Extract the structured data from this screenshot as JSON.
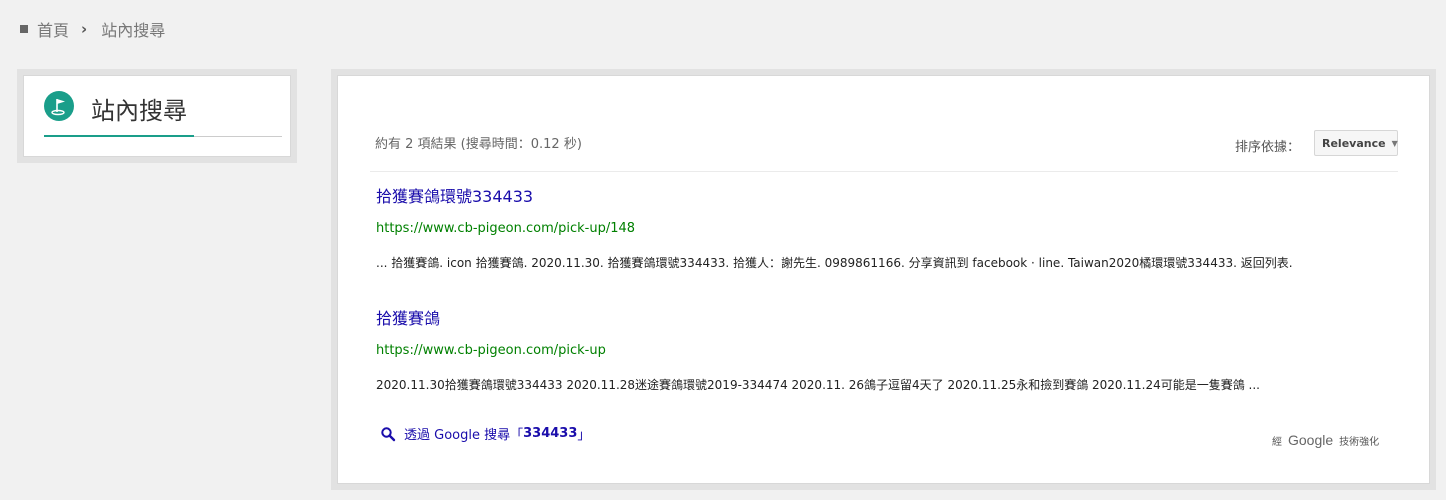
{
  "breadcrumb": {
    "home": "首頁",
    "current": "站內搜尋"
  },
  "sidebar": {
    "title": "站內搜尋",
    "accent_color": "#1a9e8a",
    "icon": "golf-flag-icon"
  },
  "results_header": {
    "summary": "約有 2 項結果 (搜尋時間：0.12 秒)",
    "sort_label": "排序依據：",
    "sort_value": "Relevance"
  },
  "results": [
    {
      "title": "拾獲賽鴿環號334433",
      "url": "https://www.cb-pigeon.com/pick-up/148",
      "snippet": "... 拾獲賽鴿. icon 拾獲賽鴿. 2020.11.30. 拾獲賽鴿環號334433. 拾獲人：謝先生. 0989861166. 分享資訊到 facebook · line. Taiwan2020橘環環號334433. 返回列表."
    },
    {
      "title": "拾獲賽鴿",
      "url": "https://www.cb-pigeon.com/pick-up",
      "snippet": "2020.11.30拾獲賽鴿環號334433 2020.11.28迷途賽鴿環號2019-334474 2020.11. 26鴿子逗留4天了 2020.11.25永和撿到賽鴿 2020.11.24可能是一隻賽鴿 ..."
    }
  ],
  "footer": {
    "google_search_prefix": "透過 Google 搜尋「",
    "google_search_query": "334433",
    "google_search_suffix": "」",
    "powered_prefix": "經",
    "powered_logo": "Google",
    "powered_suffix": "技術強化"
  }
}
